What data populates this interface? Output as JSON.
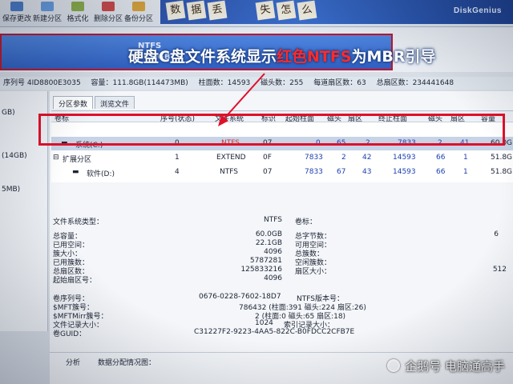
{
  "toolbar": {
    "buttons": [
      {
        "label": "保存更改",
        "icon": "save-icon"
      },
      {
        "label": "新建分区",
        "icon": "new-partition-icon"
      },
      {
        "label": "格式化",
        "icon": "format-icon"
      },
      {
        "label": "删除分区",
        "icon": "delete-partition-icon"
      },
      {
        "label": "备份分区",
        "icon": "backup-partition-icon"
      }
    ],
    "banner_deco": [
      "数",
      "据",
      "丢",
      "失",
      "怎",
      "么"
    ],
    "banner_brand": "DiskGenius"
  },
  "disk_map": {
    "partition_name": "系统(C:)",
    "partition_fs": "NTFS",
    "partition_size": "60.0GB"
  },
  "headline": {
    "part1": "硬盘C盘文件系统显示",
    "part2": "红色NTFS",
    "part3": "为MBR引导"
  },
  "disk_info": {
    "serial": "序列号  4ID8800E3035",
    "capacity": "容量：111.8GB(114473MB)",
    "cylinders": "柱面数：14593",
    "heads": "磁头数：255",
    "sectors_per_track": "每道扇区数：63",
    "total_sectors": "总扇区数：234441648"
  },
  "left_panel": [
    "GB)",
    "(14GB)",
    "5MB)"
  ],
  "tabs": [
    "分区参数",
    "浏览文件"
  ],
  "table": {
    "headers": [
      "卷标",
      "序号(状态)",
      "文件系统",
      "标识",
      "起始柱面",
      "磁头",
      "扇区",
      "终止柱面",
      "磁头",
      "扇区",
      "容量"
    ],
    "rows": [
      {
        "label": "系统(C:)",
        "index": "0",
        "fs": "NTFS",
        "id": "07",
        "start_cyl": "0",
        "head1": "65",
        "sec1": "2",
        "end_cyl": "7833",
        "head2": "2",
        "sec2": "41",
        "size": "60.0G"
      },
      {
        "label": "扩展分区",
        "index": "1",
        "fs": "EXTEND",
        "id": "0F",
        "start_cyl": "7833",
        "head1": "2",
        "sec1": "42",
        "end_cyl": "14593",
        "head2": "66",
        "sec2": "1",
        "size": "51.8G"
      },
      {
        "label": "软件(D:)",
        "index": "4",
        "fs": "NTFS",
        "id": "07",
        "start_cyl": "7833",
        "head1": "67",
        "sec1": "43",
        "end_cyl": "14593",
        "head2": "66",
        "sec2": "1",
        "size": "51.8G"
      }
    ]
  },
  "fs_info": {
    "type_label": "文件系统类型：",
    "type_value": "NTFS",
    "volume_label": "卷标：",
    "left": [
      {
        "k": "总容量：",
        "v": "60.0GB"
      },
      {
        "k": "已用空间：",
        "v": "22.1GB"
      },
      {
        "k": "簇大小：",
        "v": "4096"
      },
      {
        "k": "已用簇数：",
        "v": "5787281"
      },
      {
        "k": "总扇区数：",
        "v": "125833216"
      },
      {
        "k": "起始扇区号：",
        "v": "4096"
      }
    ],
    "right": [
      {
        "k": "总字节数：",
        "v": "6"
      },
      {
        "k": "可用空间：",
        "v": ""
      },
      {
        "k": "总簇数：",
        "v": ""
      },
      {
        "k": "空闲簇数：",
        "v": ""
      },
      {
        "k": "扇区大小：",
        "v": "512"
      }
    ],
    "serial_k": "卷序列号：",
    "serial_v": "0676-0228-7602-18D7",
    "ntfs_ver": "NTFS版本号：",
    "mft_k": "$MFT簇号：",
    "mft_v": "786432 (柱面:391 磁头:224 扇区:26)",
    "mftmirr_k": "$MFTMirr簇号：",
    "mftmirr_v": "2 (柱面:0 磁头:65 扇区:18)",
    "record_k": "文件记录大小：",
    "record_v": "1024",
    "index_k": "索引记录大小：",
    "guid_k": "卷GUID：",
    "guid_v": "C31227F2-9223-4AA5-822C-B0FDCC2CFB7E"
  },
  "analysis": {
    "button": "分析",
    "label": "数据分配情况图："
  },
  "watermark": "企鹅号 电脑通高手",
  "colors": {
    "highlight_red": "#e0102a",
    "banner_blue": "#3a6fd0",
    "ntfs_red": "#cc3333"
  }
}
